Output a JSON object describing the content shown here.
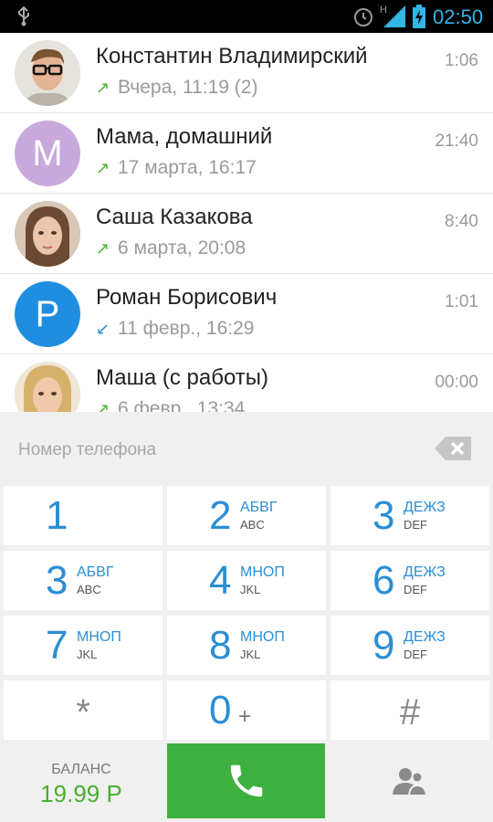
{
  "status_bar": {
    "time": "02:50",
    "network_label": "H",
    "icons": [
      "usb-icon",
      "alarm-icon",
      "signal-icon",
      "battery-charging-icon"
    ]
  },
  "recents": [
    {
      "name": "Константин Владимирский",
      "duration": "1:06",
      "direction": "outgoing",
      "when": "Вчера, 11:19 (2)",
      "avatar": {
        "type": "photo",
        "description": "man-with-glasses"
      }
    },
    {
      "name": "Мама, домашний",
      "duration": "21:40",
      "direction": "outgoing",
      "when": "17 марта, 16:17",
      "avatar": {
        "type": "letter",
        "letter": "М",
        "color": "#c9a9dc"
      }
    },
    {
      "name": "Саша Казакова",
      "duration": "8:40",
      "direction": "outgoing",
      "when": "6 марта, 20:08",
      "avatar": {
        "type": "photo",
        "description": "woman-dark-hair"
      }
    },
    {
      "name": "Роман Борисович",
      "duration": "1:01",
      "direction": "incoming",
      "when": "11 февр., 16:29",
      "avatar": {
        "type": "letter",
        "letter": "Р",
        "color": "#1f8ee0"
      }
    },
    {
      "name": "Маша (с работы)",
      "duration": "00:00",
      "direction": "outgoing",
      "when": "6 февр., 13:34",
      "avatar": {
        "type": "photo",
        "description": "woman-blonde"
      }
    }
  ],
  "dialer": {
    "placeholder": "Номер телефона",
    "keys": [
      {
        "digit": "1",
        "ru": "",
        "en": ""
      },
      {
        "digit": "2",
        "ru": "АБВГ",
        "en": "ABC"
      },
      {
        "digit": "3",
        "ru": "ДЕЖЗ",
        "en": "DEF"
      },
      {
        "digit": "3",
        "ru": "АБВГ",
        "en": "ABC"
      },
      {
        "digit": "4",
        "ru": "МНОП",
        "en": "JKL"
      },
      {
        "digit": "6",
        "ru": "ДЕЖЗ",
        "en": "DEF"
      },
      {
        "digit": "7",
        "ru": "МНОП",
        "en": "JKL"
      },
      {
        "digit": "8",
        "ru": "МНОП",
        "en": "JKL"
      },
      {
        "digit": "9",
        "ru": "ДЕЖЗ",
        "en": "DEF"
      },
      {
        "digit": "*",
        "ru": "",
        "en": ""
      },
      {
        "digit": "0",
        "ru": "",
        "en": "",
        "extra": "+"
      },
      {
        "digit": "#",
        "ru": "",
        "en": ""
      }
    ],
    "balance_label": "БАЛАНС",
    "balance_value": "19.99 Р"
  },
  "colors": {
    "accent_blue": "#2a8ed4",
    "call_green": "#3db03d",
    "status_clock": "#33b5e5",
    "outgoing_arrow": "#4cae2f",
    "incoming_arrow": "#2a8ed4"
  }
}
